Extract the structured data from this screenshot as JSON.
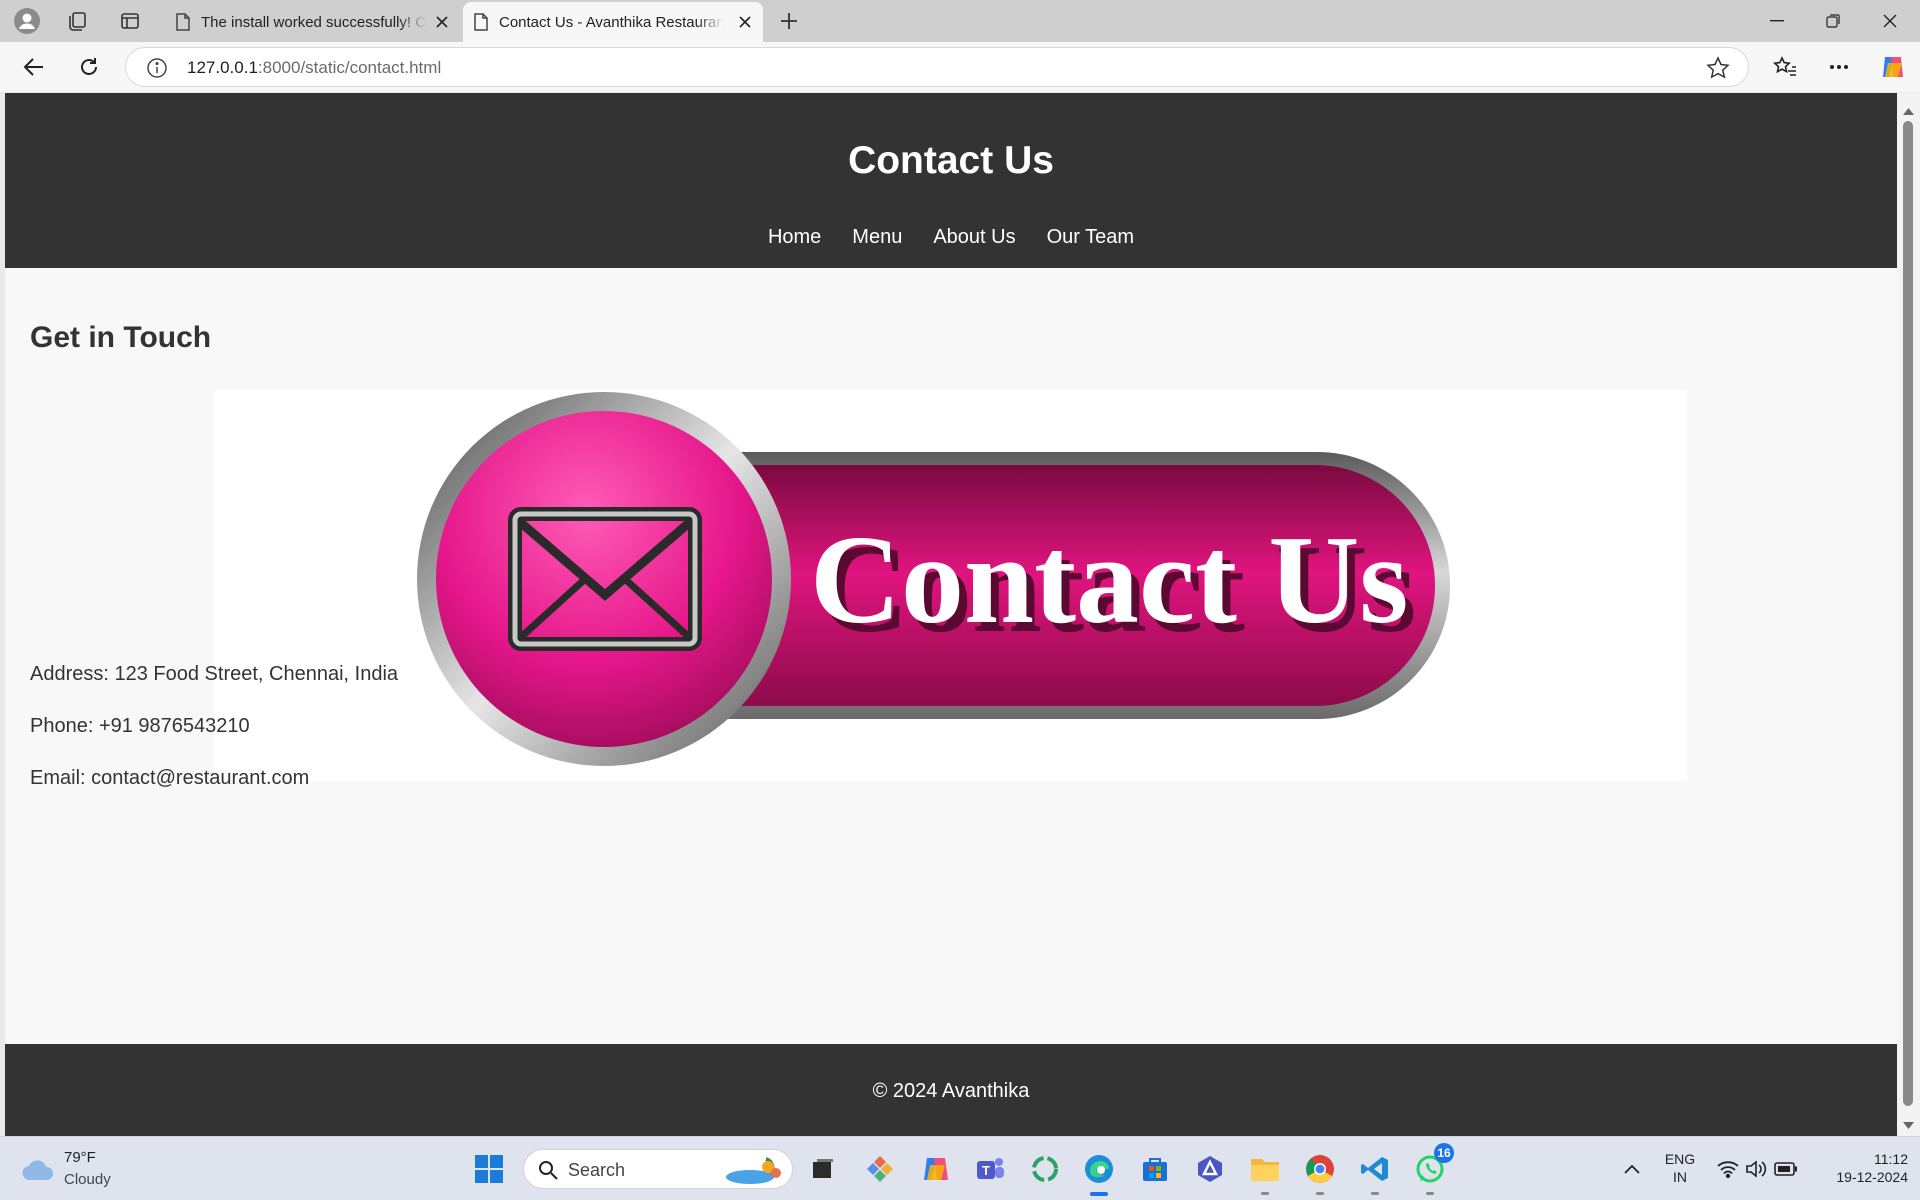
{
  "browser": {
    "tabs": [
      {
        "title": "The install worked successfully! Congratulations!",
        "active": false
      },
      {
        "title": "Contact Us - Avanthika Restaurant",
        "active": true
      }
    ],
    "url_host": "127.0.0.1",
    "url_rest": ":8000/static/contact.html"
  },
  "page": {
    "title": "Contact Us",
    "nav": [
      "Home",
      "Menu",
      "About Us",
      "Our Team"
    ],
    "section_title": "Get in Touch",
    "banner_text": "Contact Us",
    "address": "Address: 123 Food Street, Chennai, India",
    "phone": "Phone: +91 9876543210",
    "email": "Email: contact@restaurant.com",
    "footer": "© 2024 Avanthika",
    "colors": {
      "header_bg": "#333333",
      "banner_pink": "#e0147f"
    }
  },
  "taskbar": {
    "weather_temp": "79°F",
    "weather_desc": "Cloudy",
    "search_label": "Search",
    "whatsapp_badge": "16",
    "lang_top": "ENG",
    "lang_bottom": "IN",
    "time": "11:12",
    "date": "19-12-2024"
  }
}
